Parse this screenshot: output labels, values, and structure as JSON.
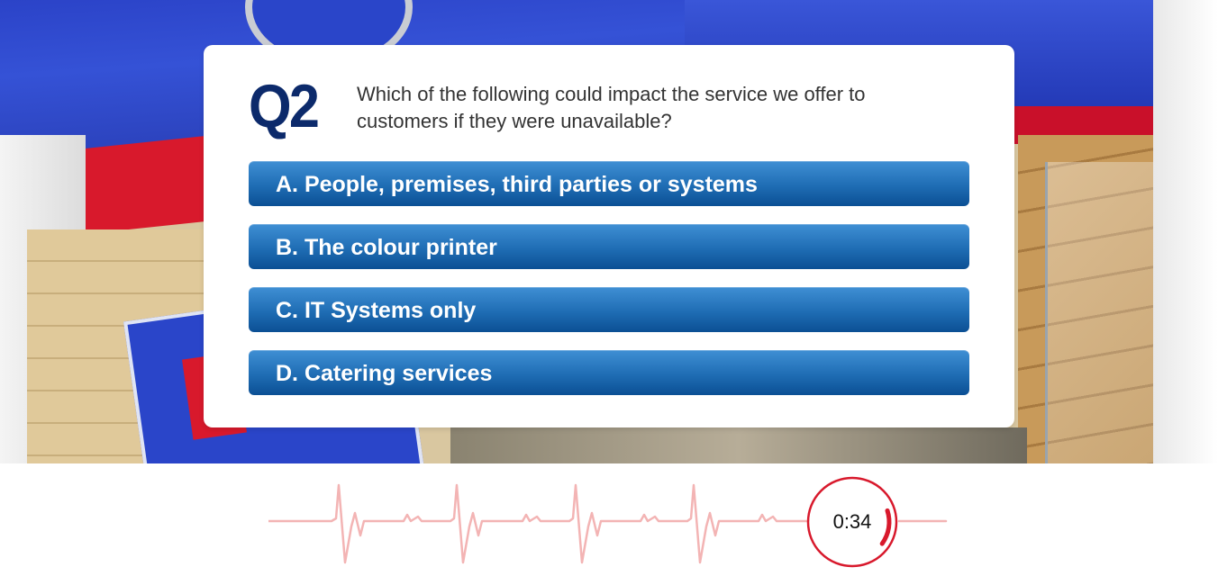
{
  "question": {
    "number": "Q2",
    "text": "Which of the following could impact the service we offer to customers if they were unavailable?",
    "answers": [
      {
        "label": "A. People, premises, third parties or systems"
      },
      {
        "label": "B. The colour printer"
      },
      {
        "label": "C. IT Systems only"
      },
      {
        "label": "D. Catering services"
      }
    ]
  },
  "timer": {
    "display": "0:34",
    "remaining_fraction": 0.15,
    "ring_color": "#d8192c"
  },
  "colors": {
    "brand_navy": "#0c2a6b",
    "button_blue": "#1f6db4",
    "pulse_line": "#f3b4b4"
  }
}
